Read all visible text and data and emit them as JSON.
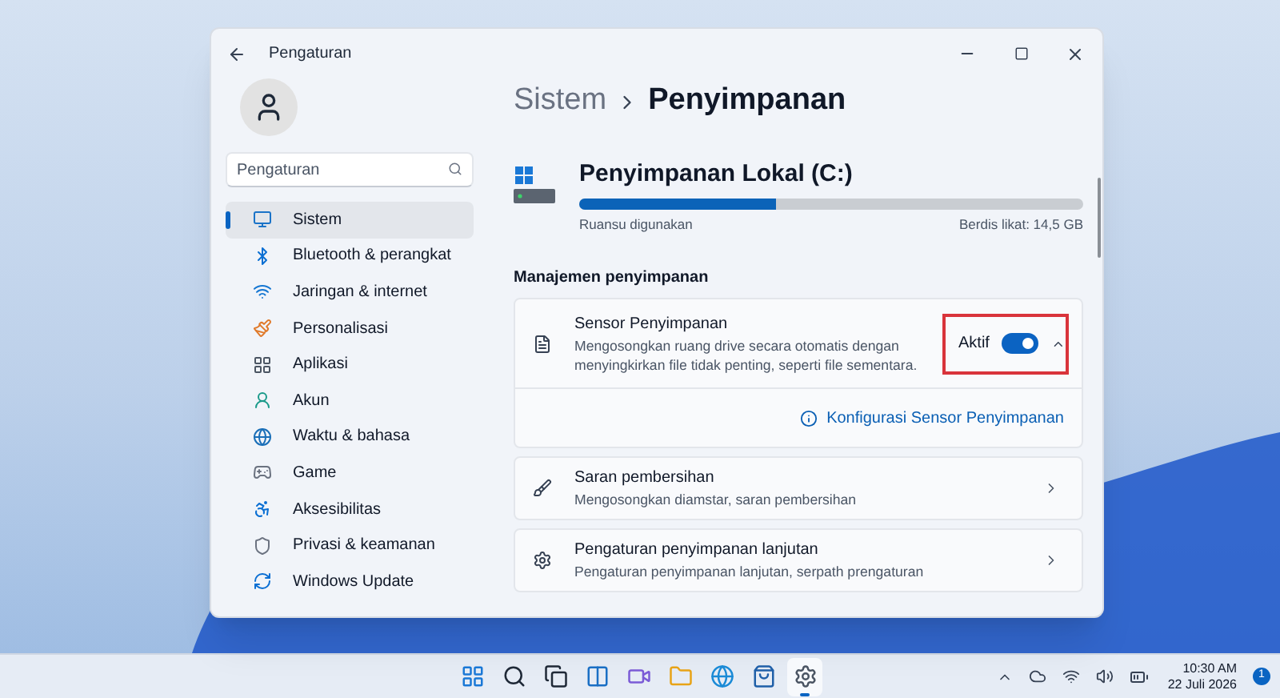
{
  "window": {
    "title": "Pengaturan"
  },
  "search": {
    "placeholder": "Pengaturan"
  },
  "sidebar": {
    "items": [
      {
        "label": "Sistem",
        "kind": "system",
        "selected": true
      },
      {
        "label": "Bluetooth & perangkat",
        "kind": "bluetooth",
        "selected": false
      },
      {
        "label": "Jaringan & internet",
        "kind": "network",
        "selected": false
      },
      {
        "label": "Personalisasi",
        "kind": "brush",
        "selected": false
      },
      {
        "label": "Aplikasi",
        "kind": "apps",
        "selected": false
      },
      {
        "label": "Akun",
        "kind": "account",
        "selected": false
      },
      {
        "label": "Waktu & bahasa",
        "kind": "time",
        "selected": false
      },
      {
        "label": "Game",
        "kind": "game",
        "selected": false
      },
      {
        "label": "Aksesibilitas",
        "kind": "access",
        "selected": false
      },
      {
        "label": "Privasi & keamanan",
        "kind": "shield",
        "selected": false
      },
      {
        "label": "Windows Update",
        "kind": "update",
        "selected": false
      }
    ]
  },
  "breadcrumb": {
    "parent": "Sistem",
    "current": "Penyimpanan"
  },
  "drive": {
    "name": "Penyimpanan Lokal (C:)",
    "level": 0.39,
    "used_label": "Ruansu digunakan",
    "free_label": "Berdis likat: 14,5 GB"
  },
  "section_title": "Manajemen penyimpanan",
  "sensor": {
    "title": "Sensor Penyimpanan",
    "description": "Mengosongkan ruang drive secara otomatis dengan menyingkirkan file tidak penting, seperti file sementara.",
    "toggle_label": "Aktif",
    "on": true,
    "expanded": true,
    "highlighted": true,
    "link": "Konfigurasi Sensor Penyimpanan"
  },
  "rows": [
    {
      "kind": "broom",
      "title": "Saran pembersihan",
      "description": "Mengosongkan diamstar, saran pembersihan"
    },
    {
      "kind": "gear",
      "title": "Pengaturan penyimpanan lanjutan",
      "description": "Pengaturan penyimpanan lanjutan, serpath prengaturan"
    }
  ],
  "taskbar": {
    "apps": [
      {
        "kind": "start",
        "active": false
      },
      {
        "kind": "search",
        "active": false
      },
      {
        "kind": "taskview",
        "active": false
      },
      {
        "kind": "widgets",
        "active": false
      },
      {
        "kind": "chat",
        "active": false
      },
      {
        "kind": "folder",
        "active": false
      },
      {
        "kind": "edge",
        "active": false
      },
      {
        "kind": "store",
        "active": false
      },
      {
        "kind": "settings",
        "active": true
      }
    ],
    "time": "10:30 AM",
    "date": "22 Juli 2026",
    "notifications": "1"
  }
}
